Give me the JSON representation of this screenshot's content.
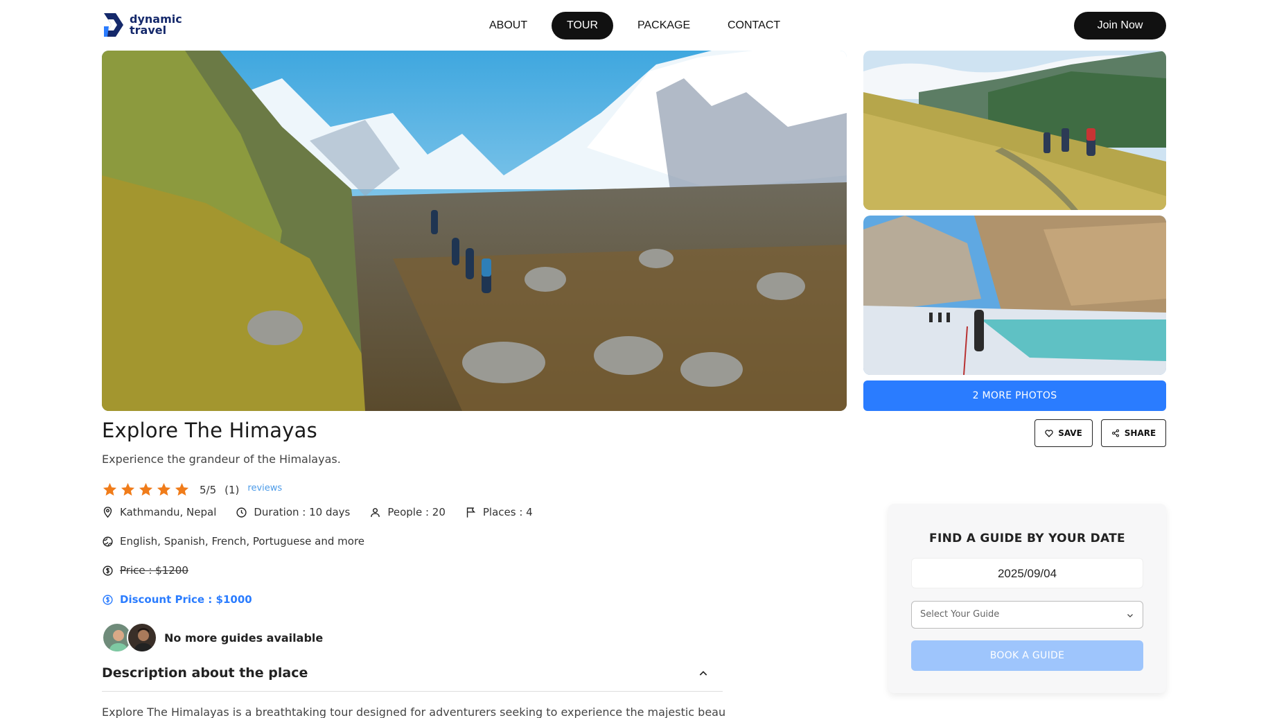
{
  "header": {
    "logo_line1": "dynamic",
    "logo_line2": "travel",
    "nav": [
      {
        "label": "ABOUT",
        "active": false
      },
      {
        "label": "TOUR",
        "active": true
      },
      {
        "label": "PACKAGE",
        "active": false
      },
      {
        "label": "CONTACT",
        "active": false
      }
    ],
    "join_label": "Join Now"
  },
  "gallery": {
    "more_photos_label": "2 MORE PHOTOS"
  },
  "actions": {
    "save_label": "SAVE",
    "share_label": "SHARE"
  },
  "tour": {
    "title": "Explore The Himayas",
    "subtitle": "Experience the grandeur of the Himalayas.",
    "rating": "5/5",
    "rating_count": "(1)",
    "reviews_label": "reviews",
    "stars": 5,
    "location": "Kathmandu, Nepal",
    "duration": "Duration : 10 days",
    "people": "People : 20",
    "places": "Places : 4",
    "languages": "English, Spanish, French, Portuguese and more",
    "price": "Price : $1200",
    "discount_price": "Discount Price : $1000",
    "guides_status": "No more guides available"
  },
  "description": {
    "heading": "Description about the place",
    "text": "Explore The Himalayas is a breathtaking tour designed for adventurers seeking to experience the majestic beauty of the"
  },
  "booking": {
    "title": "FIND A GUIDE BY YOUR DATE",
    "date": "2025/09/04",
    "select_placeholder": "Select Your Guide",
    "book_label": "BOOK A GUIDE"
  },
  "colors": {
    "accent": "#2a7cff",
    "star": "#f07c1a",
    "dark": "#111111",
    "book_disabled": "#9ec5fc"
  }
}
